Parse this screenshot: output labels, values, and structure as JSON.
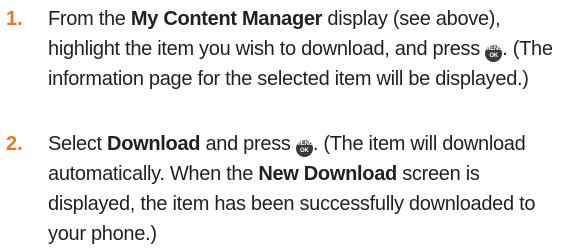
{
  "steps": [
    {
      "number": "1.",
      "t1": "From the ",
      "b1": "My Content Manager",
      "t2": " display (see above), highlight the item you wish to download, and press ",
      "t3": ". (The information page for the selected item will be displayed.)"
    },
    {
      "number": "2.",
      "t1": "Select ",
      "b1": "Download",
      "t2": " and press ",
      "t3": ". (The item will download automatically. When the ",
      "b2": "New Download",
      "t4": " screen is displayed, the item has been successfully downloaded to your phone.)"
    }
  ],
  "icons": {
    "menu_ok_key": {
      "name": "menu-ok-key-icon",
      "top_text": "MENU",
      "bottom_text": "OK"
    }
  }
}
